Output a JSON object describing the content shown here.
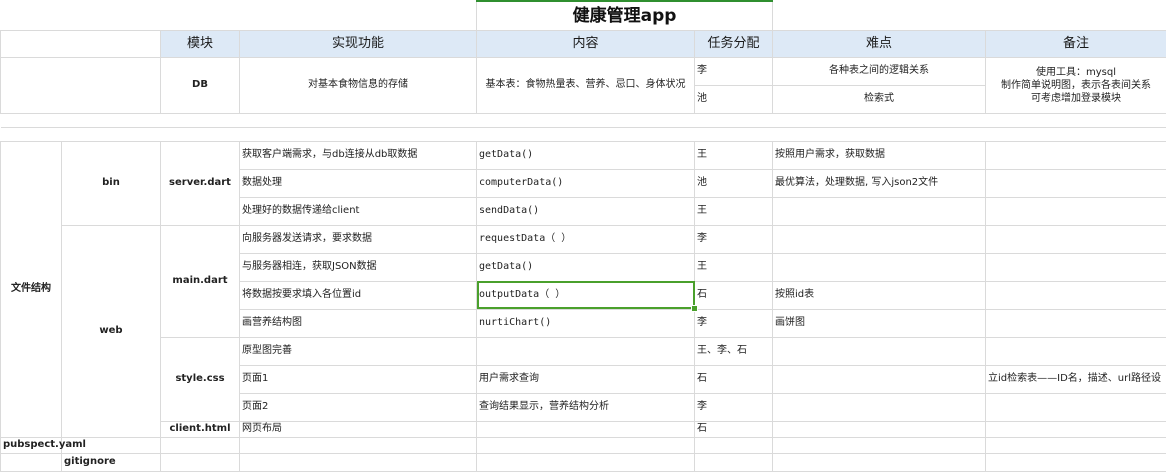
{
  "title": "健康管理app",
  "headers": [
    "模块",
    "实现功能",
    "内容",
    "任务分配",
    "难点",
    "备注"
  ],
  "db": {
    "module": "DB",
    "feature": "对基本食物信息的存储",
    "content": "基本表：食物热量表、营养、忌口、身体状况",
    "assignees": [
      "李",
      "池"
    ],
    "difficulties": [
      "各种表之间的逻辑关系",
      "检索式"
    ],
    "note_lines": [
      "使用工具：mysql",
      "制作简单说明图，表示各表间关系",
      "可考虑增加登录模块"
    ]
  },
  "file_structure_label": "文件结构",
  "bin": {
    "label": "bin",
    "file": "server.dart",
    "rows": [
      {
        "feature": "获取客户端需求，与db连接从db取数据",
        "content": "getData()",
        "assignee": "王",
        "difficulty": "按照用户需求，获取数据"
      },
      {
        "feature": "数据处理",
        "content": "computerData()",
        "assignee": "池",
        "difficulty": "最优算法，处理数据, 写入json2文件"
      },
      {
        "feature": "处理好的数据传递给client",
        "content": "sendData()",
        "assignee": "王",
        "difficulty": ""
      }
    ]
  },
  "web": {
    "label": "web",
    "main_file": "main.dart",
    "main_rows": [
      {
        "feature": "向服务器发送请求，要求数据",
        "content": "requestData（ ）",
        "assignee": "李",
        "difficulty": ""
      },
      {
        "feature": "与服务器相连，获取JSON数据",
        "content": "getData()",
        "assignee": "王",
        "difficulty": ""
      },
      {
        "feature": "将数据按要求填入各位置id",
        "content": "outputData（ ）",
        "assignee": "石",
        "difficulty": "按照id表"
      },
      {
        "feature": "画营养结构图",
        "content": "nurtiChart()",
        "assignee": "李",
        "difficulty": "画饼图"
      }
    ],
    "style_file": "style.css",
    "style_rows": [
      {
        "feature": "原型图完善",
        "content": "",
        "assignee": "王、李、石",
        "difficulty": ""
      },
      {
        "feature": "页面1",
        "content": "用户需求查询",
        "assignee": "石",
        "difficulty": ""
      },
      {
        "feature": "页面2",
        "content": "查询结果显示，营养结构分析",
        "assignee": "李",
        "difficulty": ""
      }
    ],
    "style_note": "立id检索表——ID名，描述、url路径设",
    "client_file": "client.html",
    "client_row": {
      "feature": "网页布局",
      "content": "",
      "assignee": "石",
      "difficulty": ""
    }
  },
  "extra_files": [
    "pubspect.yaml",
    "gitignore"
  ],
  "colors": {
    "header_bg": "#dde9f6",
    "selection": "#4aa02c",
    "title_border": "#2f8f2f",
    "gridline": "#dadada"
  }
}
